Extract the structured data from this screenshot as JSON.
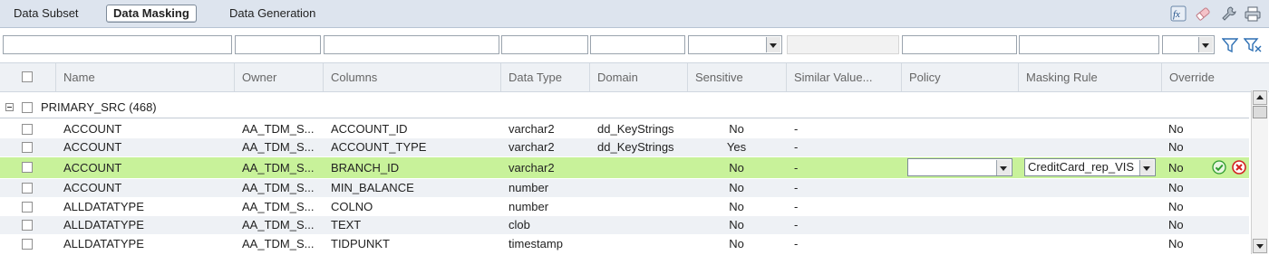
{
  "tabs": [
    {
      "label": "Data Subset",
      "active": false
    },
    {
      "label": "Data Masking",
      "active": true
    },
    {
      "label": "Data Generation",
      "active": false
    }
  ],
  "toolbar_icons": [
    "fx-expression-icon",
    "eraser-icon",
    "wrench-icon",
    "print-icon"
  ],
  "filters": {
    "type_value": "",
    "override_value": ""
  },
  "columns": [
    "Name",
    "Owner",
    "Columns",
    "Data Type",
    "Domain",
    "Sensitive",
    "Similar Value...",
    "Policy",
    "Masking Rule",
    "Override"
  ],
  "group": {
    "label": "PRIMARY_SRC (468)"
  },
  "rows": [
    {
      "name": "ACCOUNT",
      "owner": "AA_TDM_S...",
      "column": "ACCOUNT_ID",
      "datatype": "varchar2",
      "domain": "dd_KeyStrings",
      "sensitive": "No",
      "similar": "-",
      "policy": "",
      "rule": "",
      "override": "No"
    },
    {
      "name": "ACCOUNT",
      "owner": "AA_TDM_S...",
      "column": "ACCOUNT_TYPE",
      "datatype": "varchar2",
      "domain": "dd_KeyStrings",
      "sensitive": "Yes",
      "similar": "-",
      "policy": "",
      "rule": "",
      "override": "No"
    },
    {
      "name": "ACCOUNT",
      "owner": "AA_TDM_S...",
      "column": "BRANCH_ID",
      "datatype": "varchar2",
      "domain": "",
      "sensitive": "No",
      "similar": "-",
      "policy": "",
      "rule": "CreditCard_rep_VIS",
      "override": "No"
    },
    {
      "name": "ACCOUNT",
      "owner": "AA_TDM_S...",
      "column": "MIN_BALANCE",
      "datatype": "number",
      "domain": "",
      "sensitive": "No",
      "similar": "-",
      "policy": "",
      "rule": "",
      "override": "No"
    },
    {
      "name": "ALLDATATYPE",
      "owner": "AA_TDM_S...",
      "column": "COLNO",
      "datatype": "number",
      "domain": "",
      "sensitive": "No",
      "similar": "-",
      "policy": "",
      "rule": "",
      "override": "No"
    },
    {
      "name": "ALLDATATYPE",
      "owner": "AA_TDM_S...",
      "column": "TEXT",
      "datatype": "clob",
      "domain": "",
      "sensitive": "No",
      "similar": "-",
      "policy": "",
      "rule": "",
      "override": "No"
    },
    {
      "name": "ALLDATATYPE",
      "owner": "AA_TDM_S...",
      "column": "TIDPUNKT",
      "datatype": "timestamp",
      "domain": "",
      "sensitive": "No",
      "similar": "-",
      "policy": "",
      "rule": "",
      "override": "No"
    }
  ],
  "colors": {
    "selected_row": "#c8f29a",
    "alt_row": "#eef1f5",
    "accept": "#2e9b2e",
    "cancel": "#d32020"
  }
}
